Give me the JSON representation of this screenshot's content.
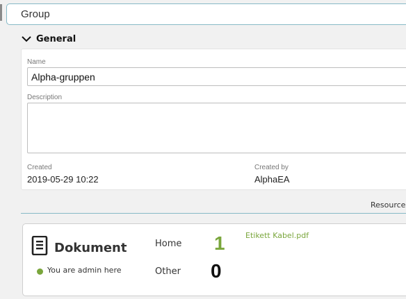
{
  "header": {
    "title": "Group"
  },
  "section": {
    "title": "General"
  },
  "fields": {
    "name_label": "Name",
    "name_value": "Alpha-gruppen",
    "description_label": "Description",
    "description_value": "",
    "created_label": "Created",
    "created_value": "2019-05-29 10:22",
    "created_by_label": "Created by",
    "created_by_value": "AlphaEA"
  },
  "resources": {
    "label": "Resources",
    "card": {
      "title": "Dokument",
      "status": "You are admin here",
      "home_label": "Home",
      "home_count": "1",
      "other_label": "Other",
      "other_count": "0",
      "file": "Etikett Kabel.pdf"
    }
  },
  "colors": {
    "accent_border": "#86b9c6",
    "green": "#7aa63c"
  },
  "icons": {
    "section_toggle": "chevron-down-icon",
    "resource": "document-icon",
    "status": "status-dot-icon"
  }
}
